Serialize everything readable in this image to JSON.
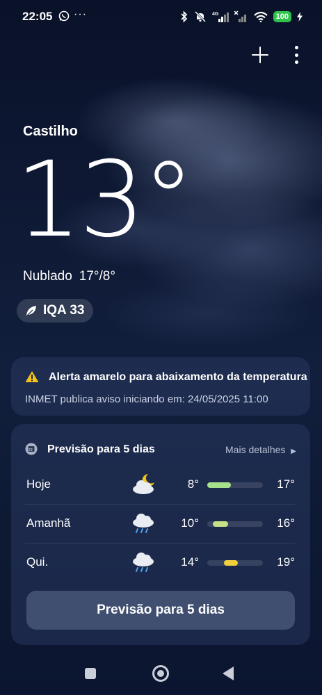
{
  "status_bar": {
    "time": "22:05",
    "more": "···",
    "battery": "100",
    "network": "4G"
  },
  "header": {
    "add_icon": "plus-icon",
    "menu_icon": "more-vertical-icon"
  },
  "weather": {
    "city": "Castilho",
    "temperature": "13°",
    "condition": "Nublado",
    "range": "17°/8°",
    "aqi": "IQA 33"
  },
  "alert": {
    "title": "Alerta amarelo para abaixamento da temperatura",
    "subtitle": "INMET publica aviso iniciando em: 24/05/2025 11:00"
  },
  "forecast": {
    "title": "Previsão para 5 dias",
    "more_link": "Mais detalhes",
    "days": [
      {
        "day": "Hoje",
        "icon": "partly-cloudy-night-icon",
        "low": "8°",
        "high": "17°",
        "range_start": 0.0,
        "range_end": 0.42,
        "color": "#a7e08a"
      },
      {
        "day": "Amanhã",
        "icon": "rain-cloud-icon",
        "low": "10°",
        "high": "16°",
        "range_start": 0.1,
        "range_end": 0.38,
        "color": "#c6e086"
      },
      {
        "day": "Qui.",
        "icon": "rain-cloud-icon",
        "low": "14°",
        "high": "19°",
        "range_start": 0.3,
        "range_end": 0.55,
        "color": "#f2cf3c"
      }
    ],
    "button": "Previsão para 5 dias"
  },
  "colors": {
    "warning": "#f3c21b",
    "battery": "#2fc24d"
  }
}
